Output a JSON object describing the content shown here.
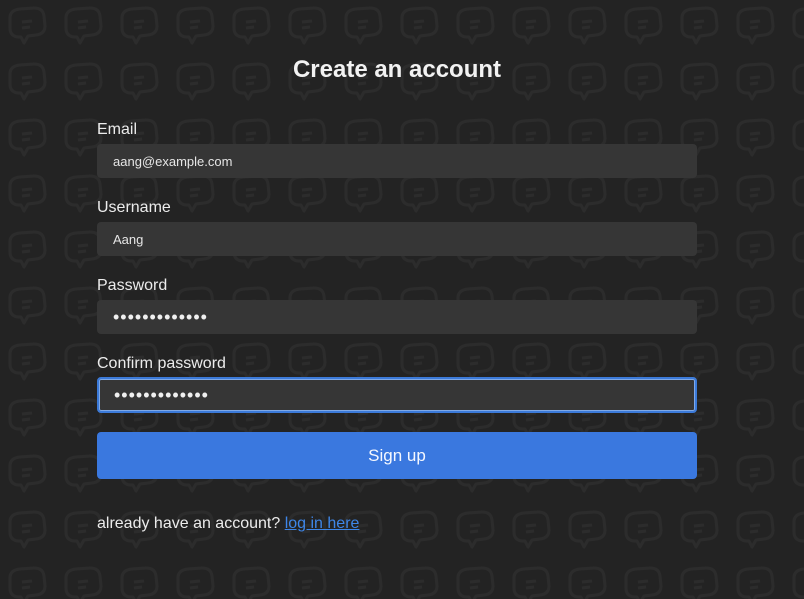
{
  "page": {
    "title": "Create an account"
  },
  "form": {
    "email": {
      "label": "Email",
      "value": "aang@example.com"
    },
    "username": {
      "label": "Username",
      "value": "Aang"
    },
    "password": {
      "label": "Password",
      "value": "•••••••••••••"
    },
    "confirm_password": {
      "label": "Confirm password",
      "value": "•••••••••••••"
    },
    "submit_label": "Sign up"
  },
  "footer": {
    "text": "already have an account?",
    "link_label": "log in here"
  },
  "colors": {
    "background": "#232323",
    "input_background": "#363636",
    "accent": "#3a78df",
    "link": "#3e86e8"
  },
  "icons": {
    "background_pattern": "chat-bubble-pattern"
  }
}
